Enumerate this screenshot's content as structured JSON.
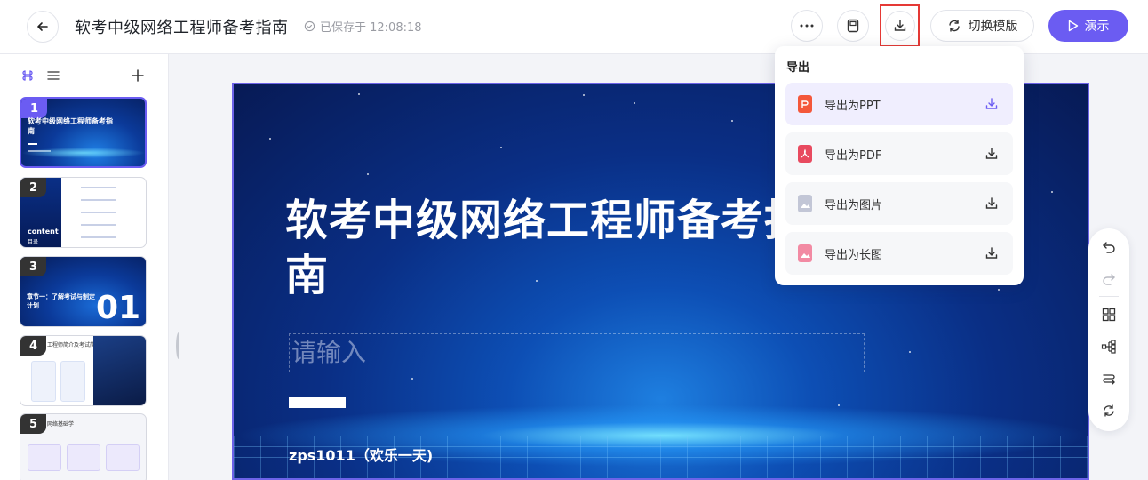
{
  "header": {
    "title": "软考中级网络工程师备考指南",
    "saved_status": "已保存于 12:08:18",
    "switch_template_label": "切换模版",
    "present_label": "演示"
  },
  "sidebar": {
    "thumbnails": [
      {
        "num": "1",
        "title": "软考中级网络工程师备考指南"
      },
      {
        "num": "2",
        "label": "content",
        "sub": "目录"
      },
      {
        "num": "3",
        "title": "章节一：了解考试与制定计划",
        "big": "01"
      },
      {
        "num": "4",
        "title": "工程师简介及考试简"
      },
      {
        "num": "5",
        "title": "网络基础学"
      }
    ]
  },
  "slide": {
    "title": "软考中级网络工程师备考指南",
    "subtitle_placeholder": "请输入",
    "author": "zps1011（欢乐一天)"
  },
  "export_menu": {
    "title": "导出",
    "items": [
      {
        "label": "导出为PPT",
        "icon": "ppt-file-icon",
        "color": "#f4573a"
      },
      {
        "label": "导出为PDF",
        "icon": "pdf-file-icon",
        "color": "#e84a5f"
      },
      {
        "label": "导出为图片",
        "icon": "image-file-icon",
        "color": "#c2c6d6"
      },
      {
        "label": "导出为长图",
        "icon": "long-image-file-icon",
        "color": "#f28aa3"
      }
    ]
  },
  "colors": {
    "accent": "#6b5cf2",
    "highlight_border": "#e53935"
  }
}
